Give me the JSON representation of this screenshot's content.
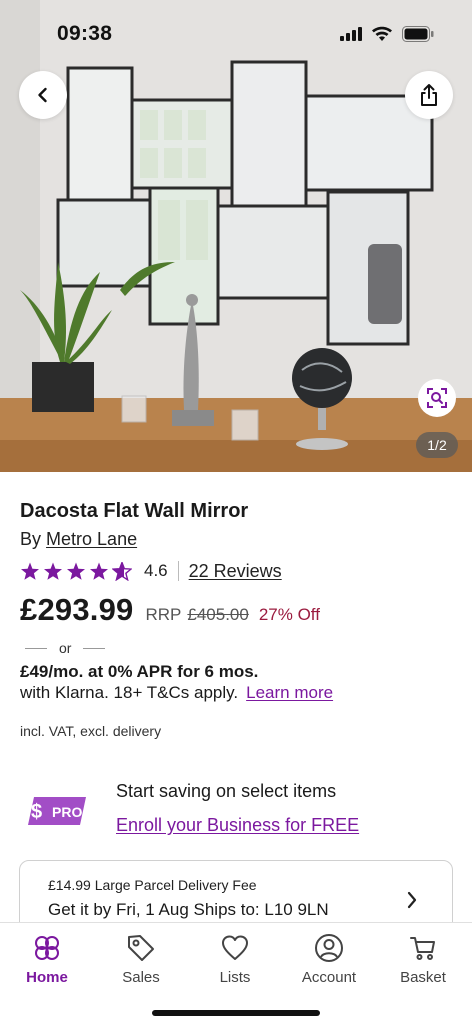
{
  "status_bar": {
    "time": "09:38",
    "icons": [
      "cellular-signal-icon",
      "wifi-icon",
      "battery-icon"
    ]
  },
  "gallery": {
    "counter": "1/2",
    "buttons": [
      "back-icon",
      "share-icon",
      "zoom-icon"
    ]
  },
  "product": {
    "title": "Dacosta Flat Wall Mirror",
    "by_label": "By",
    "brand": "Metro Lane",
    "rating": 4.6,
    "rating_text": "4.6",
    "reviews_link": "22 Reviews",
    "price": "£293.99",
    "rrp_label": "RRP",
    "rrp_value": "£405.00",
    "discount": "27% Off"
  },
  "financing": {
    "or_label": "or",
    "main": "£49/mo. at 0% APR for 6 mos.",
    "sub": "with Klarna. 18+ T&Cs apply.",
    "learn_more": "Learn more"
  },
  "vat_note": "incl. VAT, excl. delivery",
  "pro": {
    "badge": "PRO",
    "badge_symbol": "$",
    "text": "Start saving on select items",
    "link": "Enroll your Business for FREE"
  },
  "delivery": {
    "fee": "£14.99 Large Parcel Delivery Fee",
    "eta": "Get it by Fri, 1 Aug Ships to: L10 9LN"
  },
  "bottom_nav": {
    "items": [
      {
        "label": "Home",
        "icon": "home-flower-icon",
        "active": true
      },
      {
        "label": "Sales",
        "icon": "tag-icon",
        "active": false
      },
      {
        "label": "Lists",
        "icon": "heart-icon",
        "active": false
      },
      {
        "label": "Account",
        "icon": "user-icon",
        "active": false
      },
      {
        "label": "Basket",
        "icon": "cart-icon",
        "active": false
      }
    ]
  },
  "colors": {
    "accent": "#7b189f",
    "discount": "#9b1c3f",
    "star": "#7b189f"
  }
}
